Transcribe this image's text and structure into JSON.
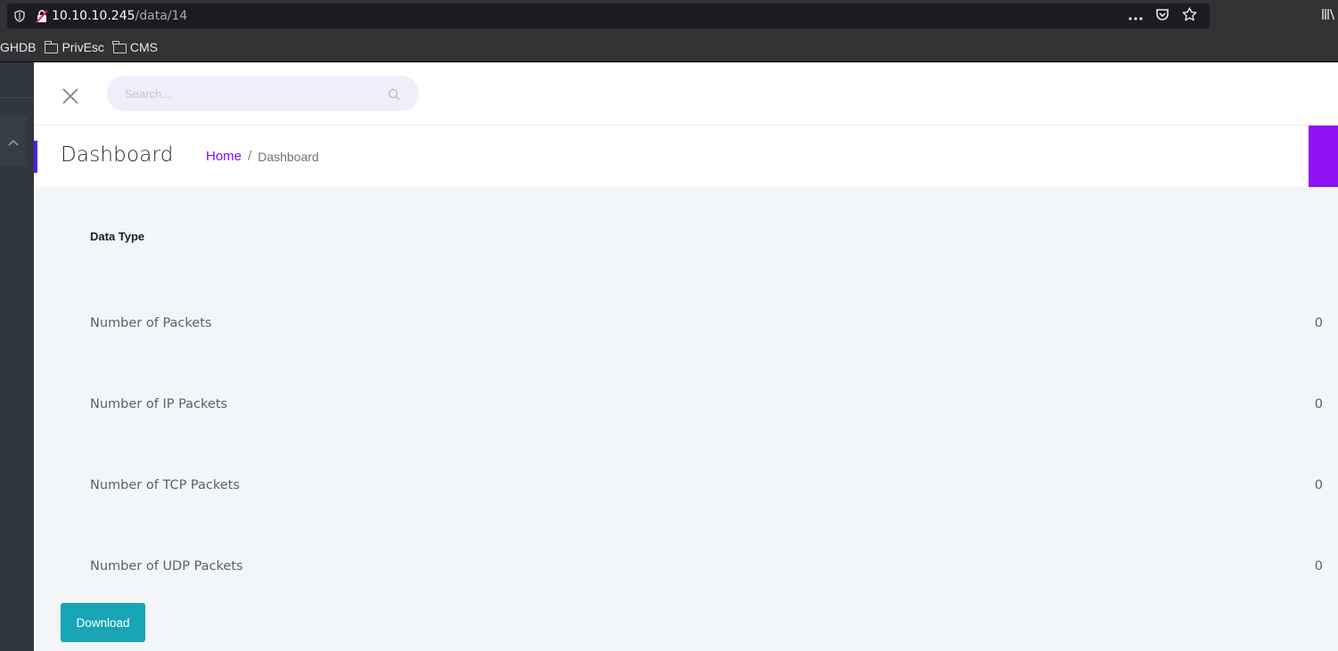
{
  "browser": {
    "url_host": "10.10.10.245",
    "url_path": "/data/14",
    "bookmarks": [
      {
        "label": "GHDB"
      },
      {
        "label": "PrivEsc"
      },
      {
        "label": "CMS"
      }
    ]
  },
  "header": {
    "search_placeholder": "Search..."
  },
  "page": {
    "title": "Dashboard",
    "breadcrumb_home": "Home",
    "breadcrumb_separator": "/",
    "breadcrumb_current": "Dashboard"
  },
  "table": {
    "header": "Data Type",
    "rows": [
      {
        "label": "Number of Packets",
        "value": "0"
      },
      {
        "label": "Number of IP Packets",
        "value": "0"
      },
      {
        "label": "Number of TCP Packets",
        "value": "0"
      },
      {
        "label": "Number of UDP Packets",
        "value": "0"
      }
    ]
  },
  "actions": {
    "download_label": "Download"
  },
  "colors": {
    "accent_blue": "#4423e6",
    "accent_purple": "#8f12f5",
    "link_purple": "#7c0ff0",
    "button_teal": "#18a5b5"
  }
}
